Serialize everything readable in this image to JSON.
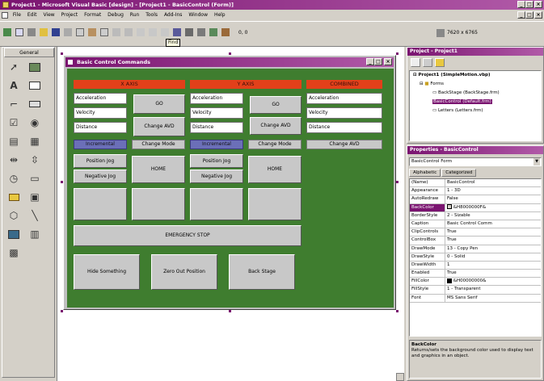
{
  "window": {
    "title": "Project1 - Microsoft Visual Basic [design] - [Project1 - BasicControl (Form)]"
  },
  "menu": [
    "File",
    "Edit",
    "View",
    "Project",
    "Format",
    "Debug",
    "Run",
    "Tools",
    "Add-Ins",
    "Window",
    "Help"
  ],
  "toolbar": {
    "coords": "0, 0",
    "size": "7620 x 6765",
    "tooltip": "Find"
  },
  "toolbox": {
    "title": "General"
  },
  "form": {
    "title": "Basic Control Commands",
    "xaxis": {
      "header": "X AXIS",
      "fields": [
        "Acceleration",
        "Velocity",
        "Distance"
      ],
      "go": "GO",
      "change_avd": "Change AVD",
      "incremental": "Incremental",
      "change_mode": "Change Mode",
      "jog_pos": "Position Jog",
      "jog_neg": "Negative Jog",
      "home": "HOME"
    },
    "yaxis": {
      "header": "Y AXIS",
      "fields": [
        "Acceleration",
        "Velocity",
        "Distance"
      ],
      "go": "GO",
      "change_avd": "Change AVD",
      "incremental": "Incremental",
      "change_mode": "Change Mode",
      "jog_pos": "Position Jog",
      "jog_neg": "Negative Jog",
      "home": "HOME"
    },
    "combined": {
      "header": "COMBINED",
      "fields": [
        "Acceleration",
        "Velocity",
        "Distance"
      ],
      "change_avd": "Change AVD"
    },
    "emergency": "EMERGENCY STOP",
    "bottom": [
      "Hide Something",
      "Zero Out Position",
      "Back Stage"
    ]
  },
  "project": {
    "title": "Project - Project1",
    "tree": [
      "Project1 (SimpleMotion.vbp)",
      "Forms",
      "BackStage (BackStage.frm)",
      "BasicControl (Default.frm)",
      "Letters (Letters.frm)"
    ]
  },
  "properties": {
    "title": "Properties - BasicControl",
    "object": "BasicControl Form",
    "tabs": [
      "Alphabetic",
      "Categorized"
    ],
    "rows": [
      [
        "(Name)",
        "BasicControl"
      ],
      [
        "Appearance",
        "1 - 3D"
      ],
      [
        "AutoRedraw",
        "False"
      ],
      [
        "BackColor",
        "&H8000000F&"
      ],
      [
        "BorderStyle",
        "2 - Sizable"
      ],
      [
        "Caption",
        "Basic Control Comm"
      ],
      [
        "ClipControls",
        "True"
      ],
      [
        "ControlBox",
        "True"
      ],
      [
        "DrawMode",
        "13 - Copy Pen"
      ],
      [
        "DrawStyle",
        "0 - Solid"
      ],
      [
        "DrawWidth",
        "1"
      ],
      [
        "Enabled",
        "True"
      ],
      [
        "FillColor",
        "&H00000000&"
      ],
      [
        "FillStyle",
        "1 - Transparent"
      ],
      [
        "Font",
        "MS Sans Serif"
      ]
    ],
    "desc_title": "BackColor",
    "desc_text": "Returns/sets the background color used to display text and graphics in an object."
  }
}
